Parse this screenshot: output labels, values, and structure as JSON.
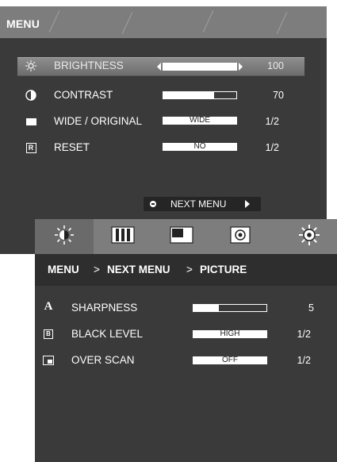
{
  "menu1": {
    "title": "MENU",
    "items": [
      {
        "label": "BRIGHTNESS",
        "value": "100",
        "control": "slider",
        "level": 1.0,
        "icon": "sun-icon",
        "selected": true
      },
      {
        "label": "CONTRAST",
        "value": "70",
        "control": "slider",
        "level": 0.7,
        "icon": "contrast-icon"
      },
      {
        "label": "WIDE / ORIGINAL",
        "value": "1/2",
        "control": "option",
        "option": "WIDE",
        "icon": "aspect-ratio-icon"
      },
      {
        "label": "RESET",
        "value": "1/2",
        "control": "option",
        "option": "NO",
        "icon": "reset-icon"
      }
    ],
    "next_menu": "NEXT MENU"
  },
  "menu2": {
    "tabs": [
      "picture-tab-icon",
      "color-tab-icon",
      "display-tab-icon",
      "volume-tab-icon",
      "settings-tab-icon"
    ],
    "breadcrumb": {
      "root": "MENU",
      "sep1": ">",
      "next": "NEXT MENU",
      "sep2": ">",
      "current": "PICTURE"
    },
    "items": [
      {
        "label": "SHARPNESS",
        "value": "5",
        "control": "slider",
        "level": 0.35,
        "icon": "sharpness-icon",
        "icon_text": "A"
      },
      {
        "label": "BLACK LEVEL",
        "value": "1/2",
        "control": "option",
        "option": "HIGH",
        "icon": "black-level-icon",
        "icon_text": "B"
      },
      {
        "label": "OVER SCAN",
        "value": "1/2",
        "control": "option",
        "option": "OFF",
        "icon": "over-scan-icon"
      }
    ]
  }
}
